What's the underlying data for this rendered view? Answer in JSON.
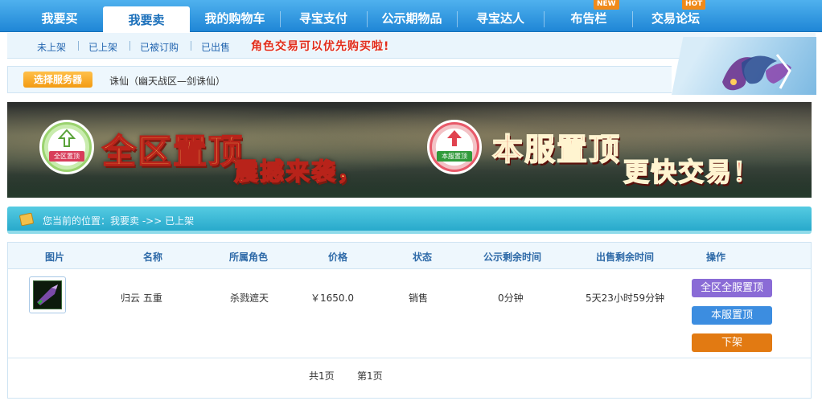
{
  "topnav": {
    "tabs": [
      {
        "label": "我要买",
        "active": false
      },
      {
        "label": "我要卖",
        "active": true
      },
      {
        "label": "我的购物车",
        "active": false
      },
      {
        "label": "寻宝支付",
        "active": false
      },
      {
        "label": "公示期物品",
        "active": false
      },
      {
        "label": "寻宝达人",
        "active": false
      },
      {
        "label": "布告栏",
        "active": false,
        "badge": "NEW"
      },
      {
        "label": "交易论坛",
        "active": false,
        "badge": "HOT"
      }
    ]
  },
  "subnav": {
    "items": [
      "未上架",
      "已上架",
      "已被订购",
      "已出售"
    ],
    "promo": "角色交易可以优先购买啦!"
  },
  "server": {
    "button": "选择服务器",
    "name": "诛仙（幽天战区—剑诛仙）"
  },
  "banner": {
    "badge_left": "全区置顶",
    "badge_right": "本服置顶",
    "text1": "全区置顶",
    "text2": "震撼来袭，",
    "text3": "本服置顶",
    "text4": "更快交易！"
  },
  "breadcrumb": {
    "text": "您当前的位置：我要卖 ->> 已上架"
  },
  "table": {
    "headers": [
      "图片",
      "名称",
      "所属角色",
      "价格",
      "状态",
      "公示剩余时间",
      "出售剩余时间",
      "操作"
    ],
    "row": {
      "name": "归云 五重",
      "role": "杀戮遮天",
      "price": "￥1650.0",
      "status": "销售",
      "public_left": "0分钟",
      "sale_left": "5天23小时59分钟",
      "actions": [
        "全区全服置顶",
        "本服置顶",
        "下架"
      ]
    },
    "pager": {
      "total": "共1页",
      "current": "第1页"
    }
  },
  "colors": {
    "nav_blue": "#1f86d6",
    "btn_purple": "#8a6bd6",
    "btn_blue": "#3c8de0",
    "btn_orange": "#e27a12",
    "badge_orange": "#f08a1a"
  }
}
